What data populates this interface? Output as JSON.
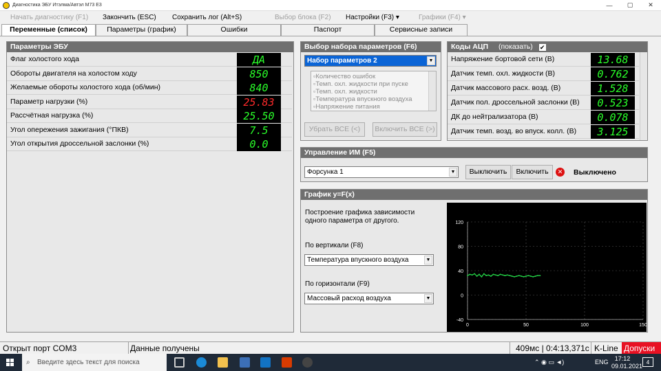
{
  "window": {
    "title": "Диагностика ЭБУ Итэлма/Автэл M73 Е3",
    "minimize": "—",
    "maximize": "▢",
    "close": "✕"
  },
  "menu": [
    {
      "label": "Начать диагностику (F1)",
      "enabled": false
    },
    {
      "label": "Закончить (ESC)",
      "enabled": true
    },
    {
      "label": "Сохранить лог (Alt+S)",
      "enabled": true
    },
    {
      "label": "Выбор блока (F2)",
      "enabled": false
    },
    {
      "label": "Настройки (F3) ▾",
      "enabled": true
    },
    {
      "label": "Графики (F4) ▾",
      "enabled": false
    }
  ],
  "tabs": [
    {
      "label": "Переменные (список)",
      "active": true
    },
    {
      "label": "Параметры (график)",
      "active": false
    },
    {
      "label": "Ошибки",
      "active": false
    },
    {
      "label": "Паспорт",
      "active": false
    },
    {
      "label": "Сервисные записи",
      "active": false
    }
  ],
  "ecu_params": {
    "title": "Параметры ЭБУ",
    "rows": [
      {
        "label": "Флаг холостого хода",
        "value": "ДА",
        "alarm": false
      },
      {
        "label": "Обороты двигателя на холостом ходу",
        "value": "850",
        "alarm": false
      },
      {
        "label": "Желаемые обороты холостого хода (об/мин)",
        "value": "840",
        "alarm": false
      },
      {
        "label": "Параметр нагрузки (%)",
        "value": "25.83",
        "alarm": true
      },
      {
        "label": "Рассчётная нагрузка (%)",
        "value": "25.50",
        "alarm": false
      },
      {
        "label": "Угол опережения зажигания (°ПКВ)",
        "value": "7.5",
        "alarm": false
      },
      {
        "label": "Угол открытия дроссельной заслонки (%)",
        "value": "0.0",
        "alarm": false
      }
    ]
  },
  "param_set": {
    "title": "Выбор набора параметров (F6)",
    "selected": "Набор параметров 2",
    "items": [
      "Количество ошибок",
      "Темп. охл. жидкости при пуске",
      "Темп. охл. жидкости",
      "Температура впускного воздуха",
      "Напряжение питания"
    ],
    "remove_all": "Убрать ВСЕ (<)",
    "add_all": "Включить ВСЕ (>)"
  },
  "adc": {
    "title": "Коды АЦП",
    "show_label": "(показать)",
    "show_checked": true,
    "rows": [
      {
        "label": "Напряжение бортовой сети (В)",
        "value": "13.68"
      },
      {
        "label": "Датчик темп. охл. жидкости (В)",
        "value": "0.762"
      },
      {
        "label": "Датчик массового расх. возд. (В)",
        "value": "1.528"
      },
      {
        "label": "Датчик пол. дроссельной заслонки (В)",
        "value": "0.523"
      },
      {
        "label": "ДК до нейтрализатора (В)",
        "value": "0.078"
      },
      {
        "label": "Датчик темп. возд. во впуск. колл. (В)",
        "value": "3.125"
      }
    ]
  },
  "actuators": {
    "title": "Управление ИМ (F5)",
    "selected": "Форсунка 1",
    "off_button": "Выключить",
    "on_button": "Включить",
    "status": "Выключено"
  },
  "plot": {
    "title": "График y=F(x)",
    "description_1": "Построение графика зависимости",
    "description_2": "одного параметра от другого.",
    "vertical_label": "По вертикали (F8)",
    "vertical_value": "Температура впускного воздуха",
    "horizontal_label": "По горизонтали (F9)",
    "horizontal_value": "Массовый расход воздуха"
  },
  "chart_data": {
    "type": "scatter",
    "title": "",
    "xlabel": "",
    "ylabel": "",
    "xlim": [
      0,
      150
    ],
    "ylim": [
      -40,
      120
    ],
    "x_ticks": [
      0,
      50,
      100,
      150
    ],
    "y_ticks": [
      -40,
      0,
      40,
      80,
      120
    ],
    "grid": true,
    "line_color": "#22cc44",
    "series": [
      {
        "x": [
          0,
          2,
          4,
          6,
          8,
          10,
          12,
          14,
          16,
          18,
          20,
          22,
          24,
          26,
          28,
          30,
          32,
          34,
          36,
          38,
          40,
          42,
          44,
          46,
          48,
          50,
          52,
          54,
          56,
          58,
          60,
          62
        ],
        "y": [
          32,
          34,
          33,
          35,
          31,
          34,
          30,
          35,
          32,
          33,
          31,
          34,
          33,
          32,
          34,
          33,
          32,
          33,
          32,
          31,
          30,
          31,
          32,
          31,
          30,
          31,
          32,
          31,
          30,
          31,
          32,
          32
        ]
      }
    ]
  },
  "status": {
    "port": "Открыт порт COM3",
    "data": "Данные получены",
    "timing": "409мс | 0:4:13,371с",
    "interface": "K-Line",
    "access": "Допуски"
  },
  "taskbar": {
    "search_placeholder": "Введите здесь текст для поиска",
    "lang": "ENG",
    "time": "17:12",
    "date": "09.01.2021",
    "notifications": "4"
  },
  "colors": {
    "panel_header": "#6f6f6f",
    "digit_green": "#2aff2a",
    "digit_red": "#ff2a2a",
    "access_red": "#e81123"
  }
}
